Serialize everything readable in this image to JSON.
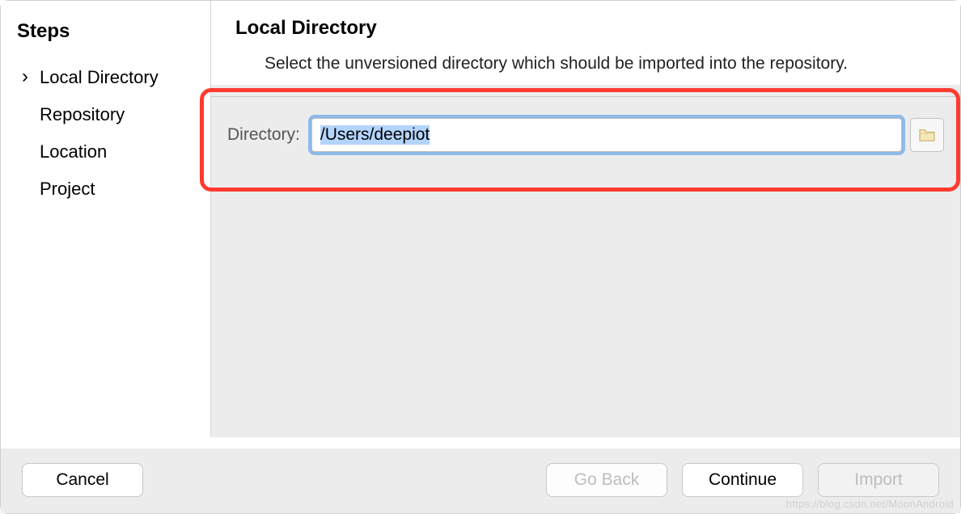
{
  "sidebar": {
    "title": "Steps",
    "items": [
      {
        "label": "Local Directory",
        "active": true
      },
      {
        "label": "Repository",
        "active": false
      },
      {
        "label": "Location",
        "active": false
      },
      {
        "label": "Project",
        "active": false
      }
    ]
  },
  "main": {
    "title": "Local Directory",
    "description": "Select the unversioned directory which should be imported into the repository.",
    "field_label": "Directory:",
    "directory_value": "/Users/deepiot"
  },
  "footer": {
    "cancel": "Cancel",
    "go_back": "Go Back",
    "continue": "Continue",
    "import": "Import"
  },
  "watermark": "https://blog.csdn.net/MoonAndroid"
}
